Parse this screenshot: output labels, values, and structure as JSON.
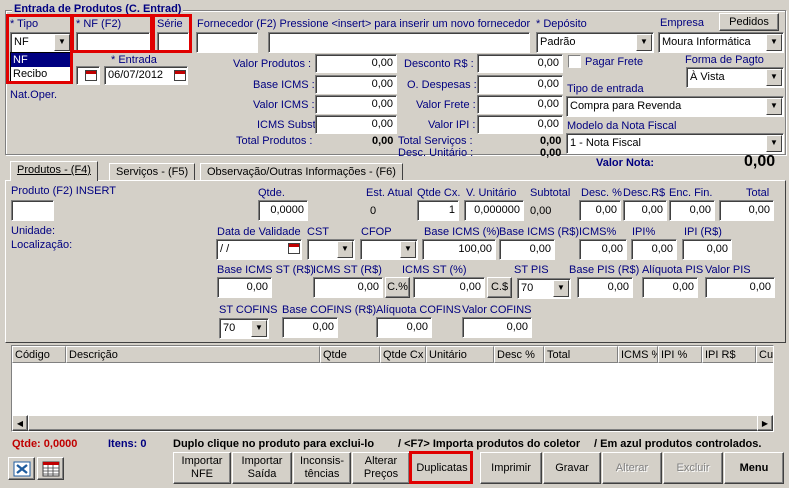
{
  "form": {
    "title": "Entrada de Produtos (C. Entrad)"
  },
  "header": {
    "tipo_label": "* Tipo",
    "tipo_value": "NF",
    "tipo_options": [
      "NF",
      "Recibo"
    ],
    "nf_label": "* NF (F2)",
    "nf_value": "",
    "serie_label": "Série",
    "serie_value": "",
    "fornecedor_label": "Fornecedor (F2) Pressione <insert> para inserir um novo fornecedor",
    "fornecedor_code": "",
    "fornecedor_name": "",
    "deposito_label": "* Depósito",
    "deposito_value": "Padrão",
    "empresa_label": "Empresa",
    "empresa_value": "Moura Informática",
    "pedidos_button": "Pedidos",
    "entrada_label": "* Entrada",
    "entrada_value": "06/07/2012",
    "pagar_frete_label": "Pagar Frete",
    "forma_pagto_label": "Forma de Pagto",
    "forma_pagto_value": "À Vista",
    "nat_oper_label": "Nat.Oper.",
    "tipo_entrada_label": "Tipo de entrada",
    "tipo_entrada_value": "Compra para Revenda",
    "modelo_nf_label": "Modelo da Nota Fiscal",
    "modelo_nf_value": "1 - Nota Fiscal",
    "valor_nota_label": "Valor Nota:",
    "valor_nota_value": "0,00"
  },
  "totals": {
    "valor_produtos_label": "Valor Produtos :",
    "valor_produtos": "0,00",
    "base_icms_label": "Base ICMS :",
    "base_icms": "0,00",
    "valor_icms_label": "Valor ICMS :",
    "valor_icms": "0,00",
    "icms_subst_label": "ICMS Subst. :",
    "icms_subst": "0,00",
    "total_produtos_label": "Total Produtos :",
    "total_produtos": "0,00",
    "desconto_label": "Desconto R$ :",
    "desconto": "0,00",
    "o_despesas_label": "O. Despesas :",
    "o_despesas": "0,00",
    "valor_frete_label": "Valor Frete :",
    "valor_frete": "0,00",
    "valor_ipi_label": "Valor IPI :",
    "valor_ipi": "0,00",
    "total_servicos_label": "Total Serviços :",
    "total_servicos": "0,00",
    "desc_unitario_label": "Desc. Unitário :",
    "desc_unitario": "0,00"
  },
  "tabs": [
    {
      "label": "Produtos - (F4)"
    },
    {
      "label": "Serviços - (F5)"
    },
    {
      "label": "Observação/Outras Informações - (F6)"
    }
  ],
  "produto": {
    "produto_label": "Produto (F2)  INSERT",
    "produto_value": "",
    "unidade_label": "Unidade:",
    "localizacao_label": "Localização:",
    "qtde_label": "Qtde.",
    "qtde_value": "0,0000",
    "est_atual_label": "Est. Atual",
    "est_atual_value": "0",
    "qtde_cx_label": "Qtde Cx.",
    "qtde_cx_value": "1",
    "v_unitario_label": "V. Unitário",
    "v_unitario_value": "0,000000",
    "subtotal_label": "Subtotal",
    "subtotal_value": "0,00",
    "desc_pct_label": "Desc. %",
    "desc_pct_value": "0,00",
    "desc_rs_label": "Desc.R$",
    "desc_rs_value": "0,00",
    "enc_fin_label": "Enc. Fin.",
    "enc_fin_value": "0,00",
    "total_label": "Total",
    "total_value": "0,00",
    "validade_label": "Data de Validade",
    "validade_value": " /  /",
    "cst_label": "CST",
    "cst_value": "",
    "cfop_label": "CFOP",
    "cfop_value": "",
    "base_icms_pct_label": "Base ICMS (%)",
    "base_icms_pct_value": "100,00",
    "base_icms_rs_label": "Base ICMS (R$)",
    "base_icms_rs_value": "0,00",
    "icms_pct_label": "ICMS%",
    "icms_pct_value": "0,00",
    "ipi_pct_label": "IPI%",
    "ipi_pct_value": "0,00",
    "ipi_rs_label": "IPI (R$)",
    "ipi_rs_value": "0,00",
    "base_icms_st_label": "Base ICMS ST (R$)",
    "base_icms_st_value": "0,00",
    "icms_st_rs_label": "ICMS ST (R$)",
    "icms_st_rs_value": "0,00",
    "icms_st_pct_label": "ICMS ST (%)",
    "icms_st_pct_value": "0,00",
    "cpct_button": "C.%",
    "crs_button": "C.$",
    "st_pis_label": "ST PIS",
    "st_pis_value": "70",
    "base_pis_label": "Base PIS (R$)",
    "base_pis_value": "0,00",
    "aliq_pis_label": "Alíquota PIS",
    "aliq_pis_value": "0,00",
    "valor_pis_label": "Valor PIS",
    "valor_pis_value": "0,00",
    "st_cofins_label": "ST COFINS",
    "st_cofins_value": "70",
    "base_cofins_label": "Base COFINS (R$)",
    "base_cofins_value": "0,00",
    "aliq_cofins_label": "Alíquota COFINS",
    "aliq_cofins_value": "0,00",
    "valor_cofins_label": "Valor COFINS",
    "valor_cofins_value": "0,00"
  },
  "grid": {
    "columns": [
      "Código",
      "Descrição",
      "Qtde",
      "Qtde Cx",
      "Unitário",
      "Desc %",
      "Total",
      "ICMS %",
      "IPI %",
      "IPI R$",
      "Cu"
    ]
  },
  "status": {
    "qtde_label": "Qtde: 0,0000",
    "itens_label": "Itens: 0",
    "hint1": "Duplo clique no produto para exclui-lo",
    "hint2": "/ <F7> Importa produtos do coletor",
    "hint3": "/ Em azul produtos controlados."
  },
  "toolbar": {
    "importar_nfe": "Importar NFE",
    "importar_saida": "Importar Saída",
    "inconsistencias": "Inconsis- tências",
    "alterar_precos": "Alterar Preços",
    "duplicatas": "Duplicatas",
    "imprimir": "Imprimir",
    "gravar": "Gravar",
    "alterar": "Alterar",
    "excluir": "Excluir",
    "menu": "Menu"
  }
}
